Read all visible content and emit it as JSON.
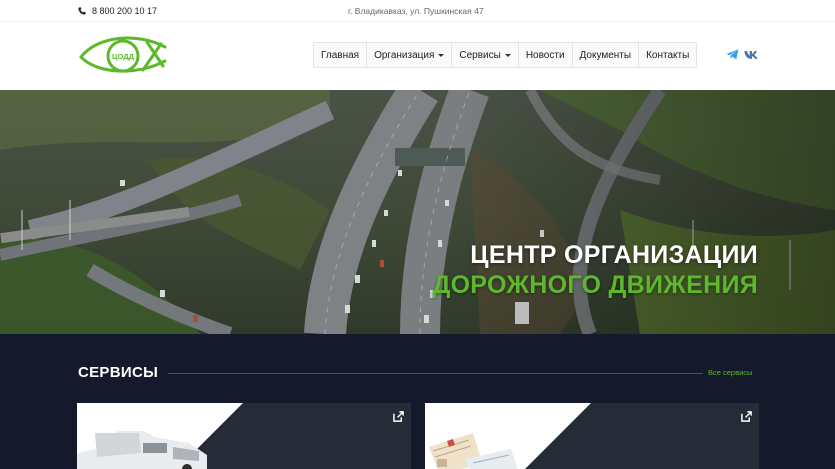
{
  "topbar": {
    "phone": "8 800 200 10 17",
    "address": "г. Владикавказ, ул. Пушкинская 47"
  },
  "logo": {
    "text": "ЦОДД"
  },
  "nav": {
    "items": [
      {
        "label": "Главная",
        "dropdown": false
      },
      {
        "label": "Организация",
        "dropdown": true
      },
      {
        "label": "Сервисы",
        "dropdown": true
      },
      {
        "label": "Новости",
        "dropdown": false
      },
      {
        "label": "Документы",
        "dropdown": false
      },
      {
        "label": "Контакты",
        "dropdown": false
      }
    ]
  },
  "social": [
    {
      "icon": "telegram-icon",
      "color": "#30a3e6"
    },
    {
      "icon": "vk-icon",
      "color": "#4a76a8"
    }
  ],
  "hero": {
    "title_line1": "ЦЕНТР ОРГАНИЗАЦИИ",
    "title_line2": "ДОРОЖНОГО ДВИЖЕНИЯ"
  },
  "services": {
    "title": "СЕРВИСЫ",
    "all_link": "Все сервисы"
  },
  "colors": {
    "accent": "#5db82e",
    "dark_bg": "#141a2b",
    "card_bg": "#262b38"
  }
}
